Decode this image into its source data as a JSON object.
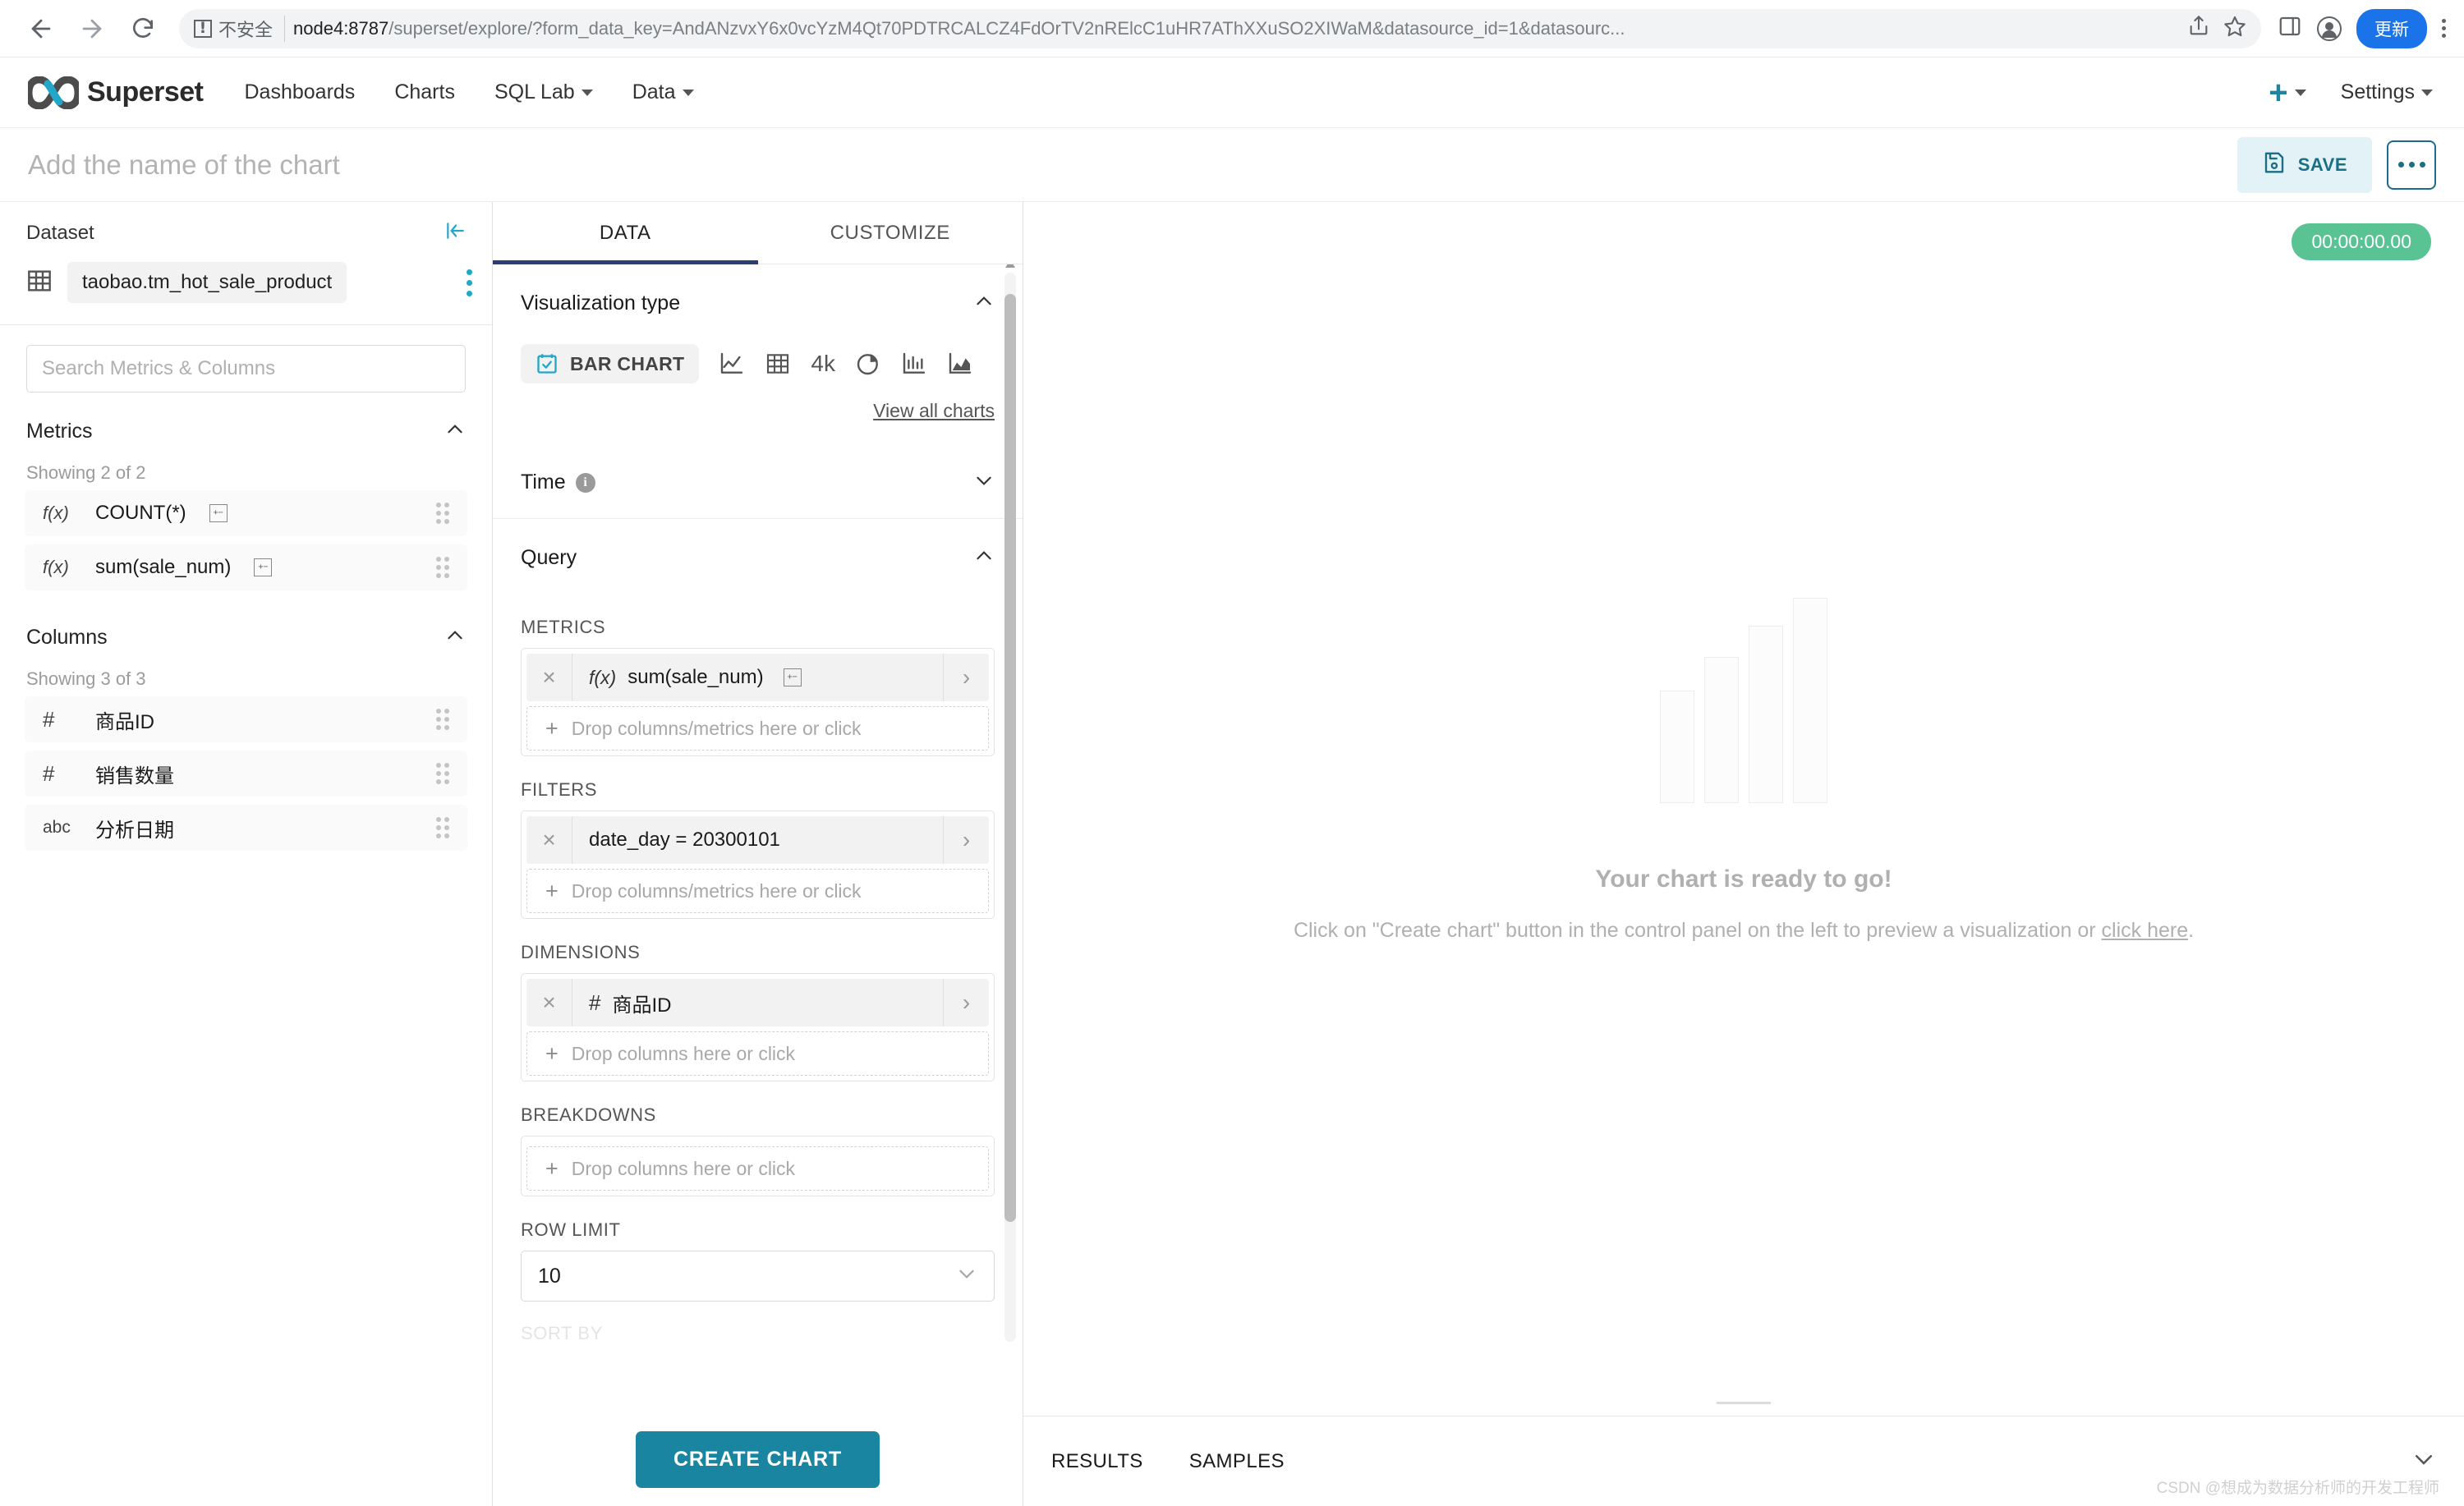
{
  "browser": {
    "security_label": "不安全",
    "url_host": "node4:8787",
    "url_path": "/superset/explore/?form_data_key=AndANzvxY6x0vcYzM4Qt70PDTRCALCZ4FdOrTV2nRElcC1uHR7AThXXuSO2XIWaM&datasource_id=1&datasourc...",
    "update_button": "更新"
  },
  "navbar": {
    "brand": "Superset",
    "items": [
      {
        "label": "Dashboards",
        "has_caret": false
      },
      {
        "label": "Charts",
        "has_caret": false
      },
      {
        "label": "SQL Lab",
        "has_caret": true
      },
      {
        "label": "Data",
        "has_caret": true
      }
    ],
    "settings_label": "Settings"
  },
  "chart_header": {
    "title_placeholder": "Add the name of the chart",
    "save_label": "SAVE"
  },
  "dataset_panel": {
    "section_label": "Dataset",
    "dataset_name": "taobao.tm_hot_sale_product",
    "search_placeholder": "Search Metrics & Columns",
    "metrics": {
      "title": "Metrics",
      "showing": "Showing 2 of 2",
      "items": [
        {
          "type": "f(x)",
          "label": "COUNT(*)",
          "has_calc_icon": true
        },
        {
          "type": "f(x)",
          "label": "sum(sale_num)",
          "has_calc_icon": true
        }
      ]
    },
    "columns": {
      "title": "Columns",
      "showing": "Showing 3 of 3",
      "items": [
        {
          "type": "#",
          "label": "商品ID"
        },
        {
          "type": "#",
          "label": "销售数量"
        },
        {
          "type": "abc",
          "label": "分析日期"
        }
      ]
    }
  },
  "control_panel": {
    "tabs": [
      {
        "label": "DATA",
        "active": true
      },
      {
        "label": "CUSTOMIZE",
        "active": false
      }
    ],
    "viz_type": {
      "title": "Visualization type",
      "selected": "BAR CHART",
      "icons": [
        "bar-chart-selected-icon",
        "line-chart-icon",
        "table-icon",
        "big-number-4k-icon",
        "pie-chart-icon",
        "histogram-icon",
        "area-chart-icon"
      ],
      "big_number_label": "4k",
      "view_all": "View all charts"
    },
    "time": {
      "title": "Time"
    },
    "query": {
      "title": "Query",
      "metrics_label": "METRICS",
      "metrics_item": {
        "type": "f(x)",
        "label": "sum(sale_num)"
      },
      "metrics_drop": "Drop columns/metrics here or click",
      "filters_label": "FILTERS",
      "filters_item": {
        "label": "date_day = 20300101"
      },
      "filters_drop": "Drop columns/metrics here or click",
      "dimensions_label": "DIMENSIONS",
      "dimensions_item": {
        "type": "#",
        "label": "商品ID"
      },
      "dimensions_drop": "Drop columns here or click",
      "breakdowns_label": "BREAKDOWNS",
      "breakdowns_drop": "Drop columns here or click",
      "row_limit_label": "ROW LIMIT",
      "row_limit_value": "10",
      "sort_by_label": "SORT BY"
    },
    "create_chart_label": "CREATE CHART"
  },
  "chart_area": {
    "timer": "00:00:00.00",
    "empty_title": "Your chart is ready to go!",
    "empty_sub_line1": "Click on \"Create chart\" button in the control panel on the left to preview a visualization or",
    "empty_link": "click here",
    "empty_sub_end": ".",
    "results_tabs": [
      {
        "label": "RESULTS"
      },
      {
        "label": "SAMPLES"
      }
    ]
  },
  "watermark": "CSDN @想成为数据分析师的开发工程师",
  "colors": {
    "accent_teal": "#20a7c9",
    "save_btn_bg": "#e2f2f6",
    "save_btn_fg": "#1a6e85",
    "create_btn_bg": "#1a85a0",
    "timer_green": "#59c393",
    "tab_underline": "#2a3f73",
    "chrome_blue": "#1a73e8"
  },
  "chart_data": {
    "type": "bar",
    "title": "",
    "categories": [
      "1",
      "2",
      "3",
      "4"
    ],
    "values": [
      55,
      72,
      87,
      100
    ],
    "xlabel": "",
    "ylabel": "",
    "note": "placeholder skeleton bars shown in empty-state, no real data rendered"
  }
}
